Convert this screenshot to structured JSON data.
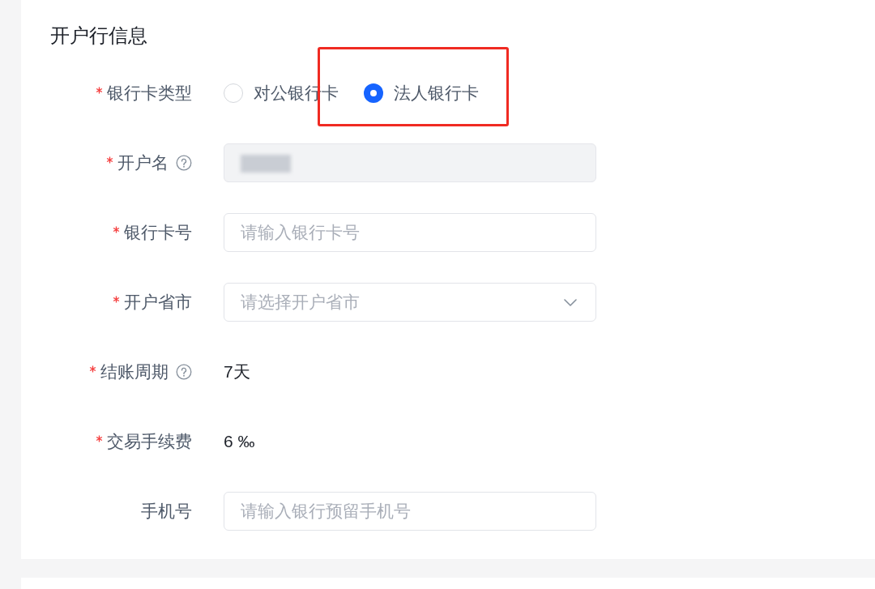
{
  "section": {
    "title": "开户行信息"
  },
  "fields": [
    {
      "kind": "radio",
      "label": "银行卡类型",
      "required": true,
      "help": false,
      "options": [
        {
          "label": "对公银行卡",
          "selected": false,
          "highlighted": false
        },
        {
          "label": "法人银行卡",
          "selected": true,
          "highlighted": true
        }
      ]
    },
    {
      "kind": "input",
      "label": "开户名",
      "required": true,
      "help": true,
      "disabled": true,
      "redacted": true
    },
    {
      "kind": "input",
      "label": "银行卡号",
      "required": true,
      "help": false,
      "disabled": false,
      "redacted": false,
      "placeholder": "请输入银行卡号"
    },
    {
      "kind": "select",
      "label": "开户省市",
      "required": true,
      "help": false,
      "placeholder": "请选择开户省市"
    },
    {
      "kind": "text",
      "label": "结账周期",
      "required": true,
      "help": true,
      "value": "7天"
    },
    {
      "kind": "text",
      "label": "交易手续费",
      "required": true,
      "help": false,
      "value": "6 ‰"
    },
    {
      "kind": "input",
      "label": "手机号",
      "required": false,
      "help": false,
      "disabled": false,
      "redacted": false,
      "placeholder": "请输入银行预留手机号"
    }
  ]
}
